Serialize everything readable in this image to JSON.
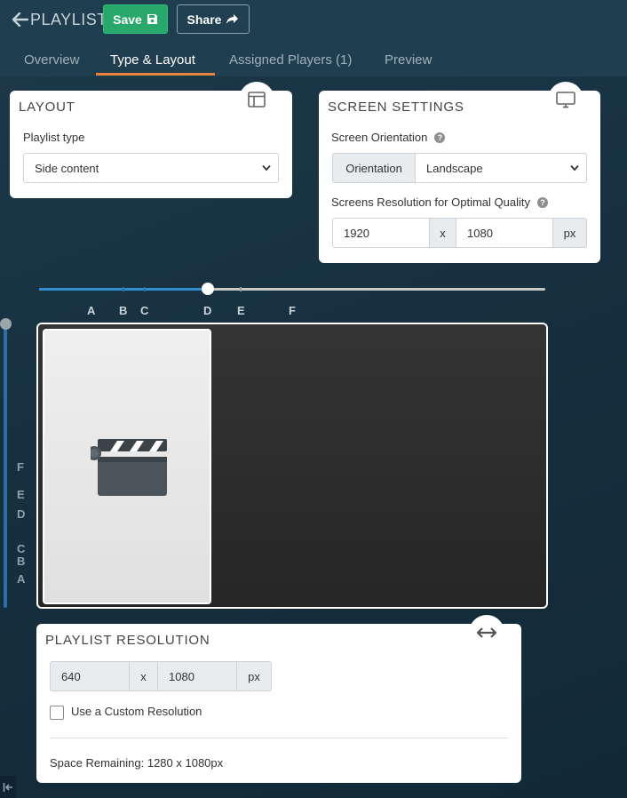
{
  "header": {
    "title": "PLAYLIST",
    "save_label": "Save",
    "share_label": "Share",
    "tabs": [
      {
        "label": "Overview",
        "active": false
      },
      {
        "label": "Type & Layout",
        "active": true
      },
      {
        "label": "Assigned Players (1)",
        "active": false
      },
      {
        "label": "Preview",
        "active": false
      }
    ]
  },
  "layout_card": {
    "title": "LAYOUT",
    "playlist_type_label": "Playlist type",
    "playlist_type_value": "Side content",
    "icon": "layout-icon"
  },
  "screen_card": {
    "title": "SCREEN SETTINGS",
    "orientation_label": "Screen Orientation",
    "orientation_addon": "Orientation",
    "orientation_value": "Landscape",
    "resolution_label": "Screens Resolution for Optimal Quality",
    "width": "1920",
    "separator": "x",
    "height": "1080",
    "unit": "px",
    "icon": "monitor-icon"
  },
  "horizontal_slider": {
    "markers": [
      "A",
      "B",
      "C",
      "D",
      "E",
      "F"
    ],
    "selected": "D"
  },
  "vertical_slider": {
    "markers": [
      "F",
      "E",
      "D",
      "C",
      "B",
      "A"
    ]
  },
  "preview": {
    "zone_icon": "clapperboard-icon"
  },
  "playlist_resolution": {
    "title": "PLAYLIST RESOLUTION",
    "width": "640",
    "separator": "x",
    "height": "1080",
    "unit": "px",
    "custom_label": "Use a Custom Resolution",
    "custom_checked": false,
    "remaining": "Space Remaining: 1280 x 1080px",
    "icon": "resize-horizontal-icon"
  },
  "colors": {
    "accent": "#e9823a",
    "save": "#28a86b",
    "slider": "#2f8fd0",
    "background": "#1d3a4b"
  }
}
